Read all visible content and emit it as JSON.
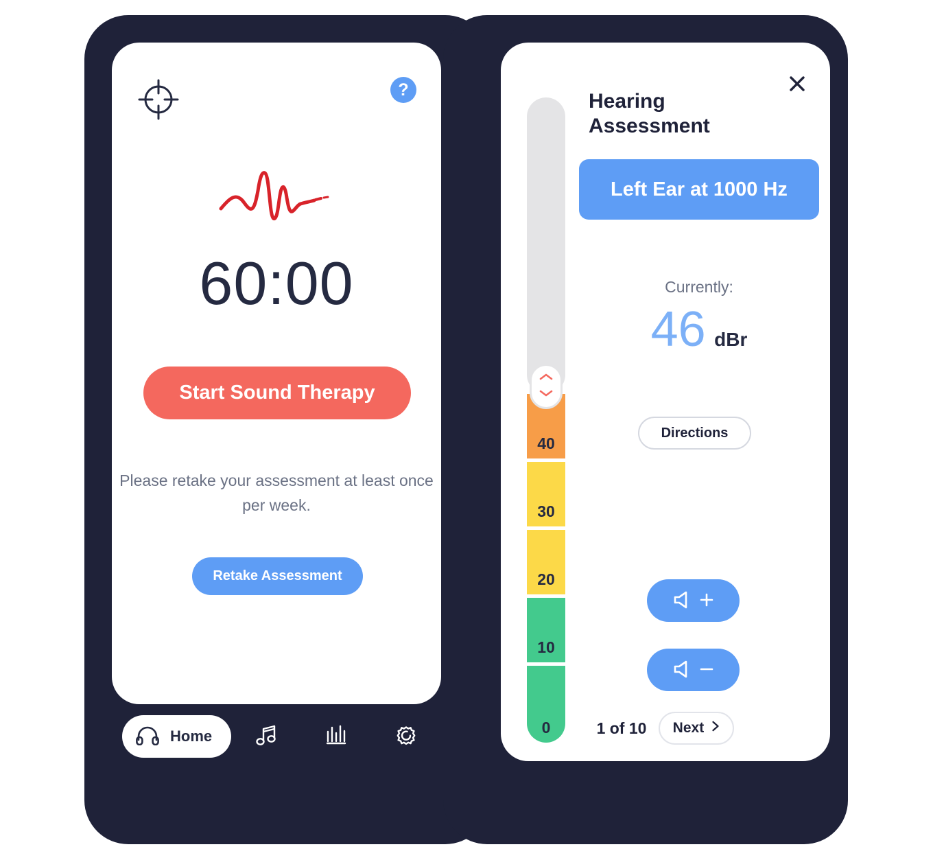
{
  "theme": {
    "frame_color": "#1f2239",
    "accent_blue": "#5e9df5",
    "accent_coral": "#f4685e",
    "text_dark": "#1f2239",
    "text_muted": "#6a7184",
    "band_orange": "#f79d48",
    "band_yellow": "#fcd948",
    "band_green": "#43ca8d",
    "track_empty": "#e4e4e6"
  },
  "left_phone": {
    "topbar": {
      "target_icon": "target-icon",
      "help_icon": "help-icon",
      "help_label": "?"
    },
    "waveform_icon": "waveform-icon",
    "timer": "60:00",
    "start_button_label": "Start Sound Therapy",
    "retake_note": "Please retake your assessment\nat least once per week.",
    "retake_button_label": "Retake Assessment",
    "nav": {
      "items": [
        {
          "label": "Home",
          "icon": "headphones-icon",
          "active": true
        },
        {
          "label": "",
          "icon": "music-note-icon",
          "active": false
        },
        {
          "label": "",
          "icon": "bar-chart-icon",
          "active": false
        },
        {
          "label": "",
          "icon": "gear-icon",
          "active": false
        }
      ]
    }
  },
  "right_phone": {
    "close_icon": "close-icon",
    "title": "Hearing\nAssessment",
    "ear_frequency_banner": "Left Ear at 1000 Hz",
    "currently_label": "Currently:",
    "level_value": "46",
    "level_unit": "dBr",
    "directions_button_label": "Directions",
    "volume_up_label": "+",
    "volume_down_label": "−",
    "page_indicator": "1 of 10",
    "next_button_label": "Next",
    "slider": {
      "bands": [
        {
          "label": "40",
          "color": "#f79d48"
        },
        {
          "label": "30",
          "color": "#fcd948"
        },
        {
          "label": "20",
          "color": "#fcd948"
        },
        {
          "label": "10",
          "color": "#43ca8d"
        },
        {
          "label": "0",
          "color": "#43ca8d"
        }
      ],
      "thumb_up_icon": "chevron-up-icon",
      "thumb_down_icon": "chevron-down-icon"
    }
  }
}
